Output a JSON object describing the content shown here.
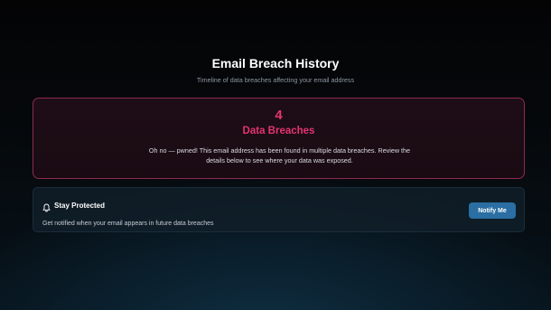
{
  "header": {
    "title": "Email Breach History",
    "subtitle": "Timeline of data breaches affecting your email address"
  },
  "breach_summary": {
    "count": "4",
    "label": "Data Breaches",
    "message": "Oh no — pwned! This email address has been found in multiple data breaches. Review the details below to see where your data was exposed."
  },
  "protection": {
    "icon": "bell-icon",
    "title": "Stay Protected",
    "description": "Get notified when your email appears in future data breaches",
    "button_label": "Notify Me"
  },
  "colors": {
    "accent_pink": "#e4346f",
    "button_blue": "#2a6ea3"
  }
}
